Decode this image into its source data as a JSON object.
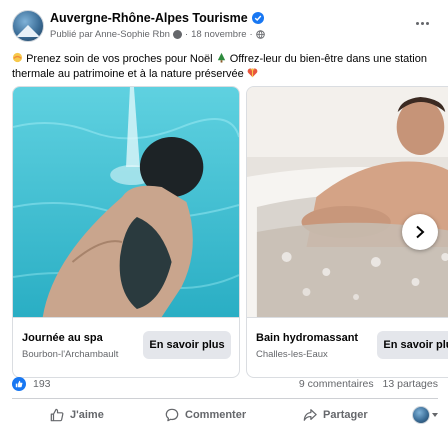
{
  "post": {
    "page_name": "Auvergne-Rhône-Alpes Tourisme",
    "verified": true,
    "published_by": "Publié par Anne-Sophie Rbn",
    "date": "18 novembre",
    "separator": "·",
    "text": "Prenez soin de vos proches pour Noël 🎄 Offrez-leur du bien-être dans une station thermale au patrimoine et à la nature préservée",
    "text_part1": "Prenez soin de vos proches pour Noël",
    "text_part2": "Offrez-leur du bien-être dans une station thermale au patrimoine et à la nature préservée"
  },
  "carousel": {
    "cards": [
      {
        "title": "Journée au spa",
        "subtitle": "Bourbon-l'Archambault",
        "cta": "En savoir plus"
      },
      {
        "title": "Bain hydromassant",
        "subtitle": "Challes-les-Eaux",
        "cta": "En savoir plus"
      }
    ]
  },
  "stats": {
    "reactions": "193",
    "comments": "9 commentaires",
    "shares": "13 partages"
  },
  "actions": {
    "like": "J'aime",
    "comment": "Commenter",
    "share": "Partager"
  },
  "icons": {
    "verified": "verified-badge-icon",
    "audience": "globe-icon",
    "more": "more-options-icon",
    "next": "chevron-right-icon",
    "like": "thumbs-up-icon",
    "comment": "comment-bubble-icon",
    "share": "share-arrow-icon"
  },
  "colors": {
    "accent": "#1877f2",
    "secondary_text": "#65676b",
    "button_bg": "#e4e6eb",
    "pool_water": "#3fc1d6"
  }
}
